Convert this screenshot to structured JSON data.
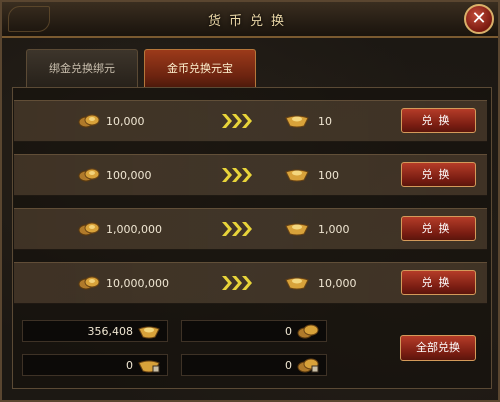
{
  "window": {
    "title": "货币兑换"
  },
  "tabs": [
    {
      "label": "绑金兑换绑元",
      "active": false
    },
    {
      "label": "金币兑换元宝",
      "active": true
    }
  ],
  "rows": [
    {
      "amount": "10,000",
      "result": "10",
      "button": "兑换"
    },
    {
      "amount": "100,000",
      "result": "100",
      "button": "兑换"
    },
    {
      "amount": "1,000,000",
      "result": "1,000",
      "button": "兑换"
    },
    {
      "amount": "10,000,000",
      "result": "10,000",
      "button": "兑换"
    }
  ],
  "balances": {
    "gold": "356,408",
    "gold_converted": "0",
    "bound_gold": "0",
    "bound_converted": "0"
  },
  "exchange_all_label": "全部兑换",
  "icons": {
    "close": "close-icon",
    "coin": "gold-coin-icon",
    "arrow": "arrow-right-icon",
    "ingot": "gold-ingot-icon"
  },
  "colors": {
    "accent": "#b53c28",
    "frame": "#7a5a30",
    "arrow": "#e8d43a",
    "gold": "#d8a23a"
  }
}
